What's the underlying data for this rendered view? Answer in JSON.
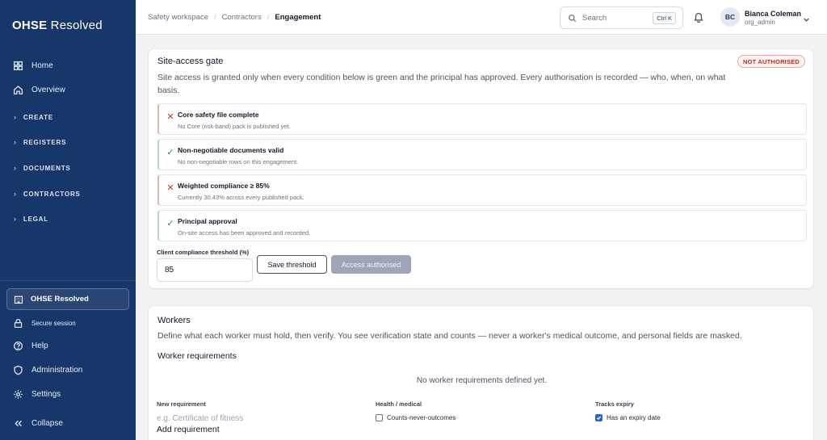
{
  "brand": {
    "bold": "OHSE",
    "light": " Resolved"
  },
  "sidebar": {
    "items": [
      {
        "label": "Home",
        "icon": "grid-icon"
      },
      {
        "label": "Overview",
        "icon": "home-icon"
      }
    ],
    "sections": [
      "CREATE",
      "REGISTERS",
      "DOCUMENTS",
      "CONTRACTORS",
      "LEGAL"
    ],
    "org": "OHSE Resolved",
    "secure": "Secure session",
    "bottom": [
      {
        "label": "Help",
        "icon": "help-icon"
      },
      {
        "label": "Administration",
        "icon": "shield-icon"
      },
      {
        "label": "Settings",
        "icon": "gear-icon"
      },
      {
        "label": "Collapse",
        "icon": "collapse-icon"
      }
    ]
  },
  "topbar": {
    "breadcrumb": [
      "Safety workspace",
      "Contractors",
      "Engagement"
    ],
    "search_placeholder": "Search",
    "search_shortcut": "Ctrl K",
    "user": {
      "initials": "BC",
      "name": "Bianca Coleman",
      "role": "org_admin"
    }
  },
  "gate": {
    "title": "Site-access gate",
    "status_badge": "NOT AUTHORISED",
    "description": "Site access is granted only when every condition below is green and the principal has approved. Every authorisation is recorded — who, when, on what basis.",
    "conditions": [
      {
        "title": "Core safety file complete",
        "detail": "No Core (risk-band) pack is published yet.",
        "state": "fail"
      },
      {
        "title": "Non-negotiable documents valid",
        "detail": "No non-negotiable rows on this engagement.",
        "state": "pass"
      },
      {
        "title": "Weighted compliance ≥ 85%",
        "detail": "Currently 30.43% across every published pack.",
        "state": "fail"
      },
      {
        "title": "Principal approval",
        "detail": "On-site access has been approved and recorded.",
        "state": "pass"
      }
    ],
    "threshold_label": "Client compliance threshold (%)",
    "threshold_value": "85",
    "save_label": "Save threshold",
    "access_label": "Access authorised"
  },
  "workers": {
    "title": "Workers",
    "description": "Define what each worker must hold, then verify. You see verification state and counts — never a worker's medical outcome, and personal fields are masked.",
    "requirements_title": "Worker requirements",
    "empty_message": "No worker requirements defined yet.",
    "new_requirement_label": "New requirement",
    "new_requirement_placeholder": "e.g. Certificate of fitness",
    "health_label": "Health / medical",
    "health_option": "Counts-never-outcomes",
    "health_checked": false,
    "expiry_label": "Tracks expiry",
    "expiry_option": "Has an expiry date",
    "expiry_checked": true,
    "add_label": "Add requirement"
  }
}
